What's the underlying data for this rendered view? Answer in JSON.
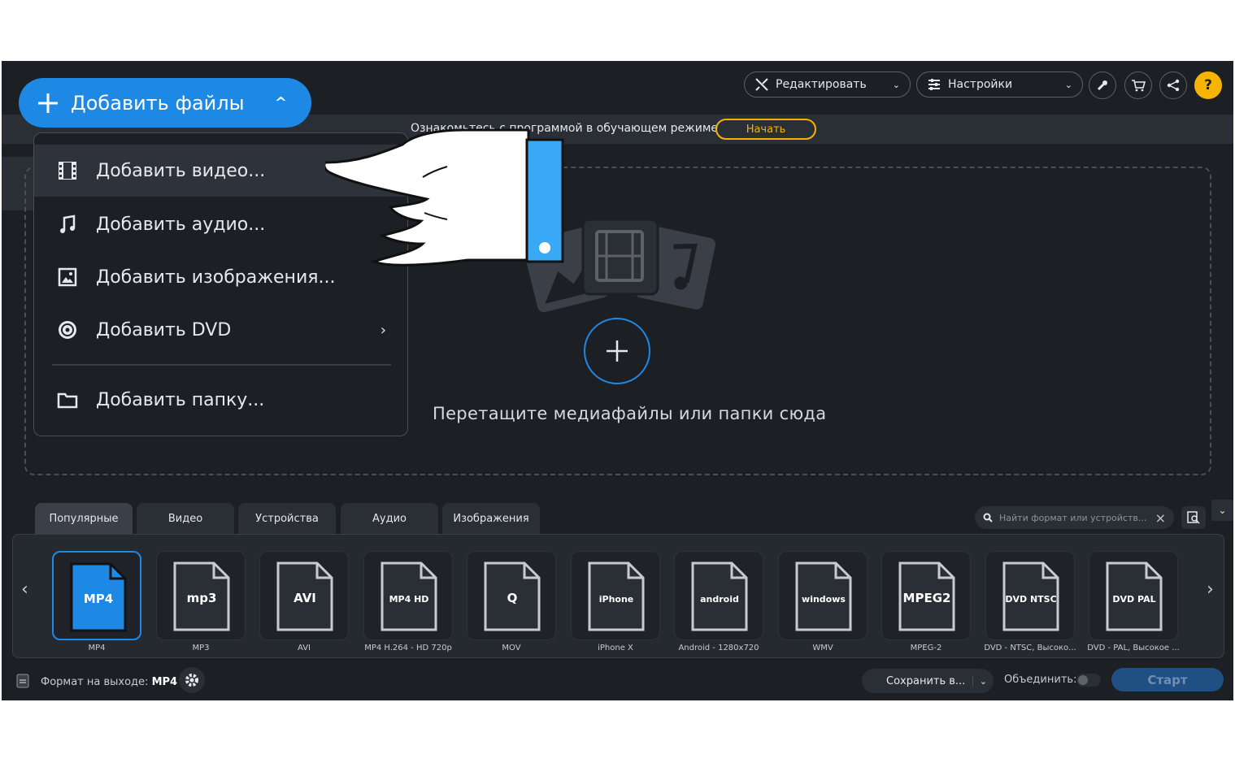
{
  "toolbar": {
    "edit_label": "Редактировать",
    "settings_label": "Настройки",
    "help_label": "?"
  },
  "tutorial": {
    "text": "Ознакомьтесь с программой в обучающем режиме",
    "start_label": "Начать"
  },
  "add_files": {
    "label": "Добавить файлы",
    "menu": [
      {
        "label": "Добавить видео...",
        "icon": "film-icon"
      },
      {
        "label": "Добавить аудио...",
        "icon": "music-note-icon"
      },
      {
        "label": "Добавить изображения...",
        "icon": "image-icon"
      },
      {
        "label": "Добавить DVD",
        "icon": "disc-icon"
      },
      {
        "label": "Добавить папку...",
        "icon": "folder-icon"
      }
    ]
  },
  "dropzone": {
    "text": "Перетащите медиафайлы или папки сюда"
  },
  "tabs": [
    "Популярные",
    "Видео",
    "Устройства",
    "Аудио",
    "Изображения"
  ],
  "search": {
    "placeholder": "Найти формат или устройств..."
  },
  "formats": [
    {
      "label": "MP4",
      "badge": "MP4"
    },
    {
      "label": "MP3",
      "badge": "mp3"
    },
    {
      "label": "AVI",
      "badge": "AVI"
    },
    {
      "label": "MP4 H.264 - HD 720p",
      "badge": "MP4 HD"
    },
    {
      "label": "MOV",
      "badge": "Q"
    },
    {
      "label": "iPhone X",
      "badge": "iPhone"
    },
    {
      "label": "Android - 1280x720",
      "badge": "android"
    },
    {
      "label": "WMV",
      "badge": "windows"
    },
    {
      "label": "MPEG-2",
      "badge": "MPEG2"
    },
    {
      "label": "DVD - NTSC, Высоко...",
      "badge": "DVD NTSC"
    },
    {
      "label": "DVD - PAL, Высокое ...",
      "badge": "DVD PAL"
    }
  ],
  "status": {
    "output_label": "Формат на выходе:",
    "output_value": "MP4",
    "save_label": "Сохранить в...",
    "merge_label": "Объединить:",
    "start_label": "Старт"
  },
  "colors": {
    "accent": "#1e88e5",
    "highlight": "#f4b400",
    "background": "#1c1f24"
  }
}
